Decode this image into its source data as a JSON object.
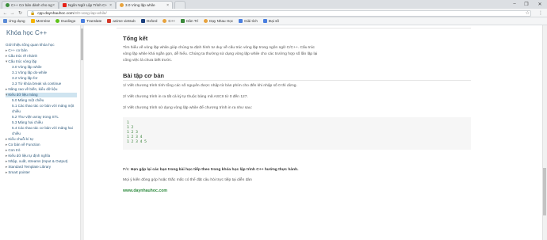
{
  "browser": {
    "tabs": [
      {
        "title": "C++ Cơ bản dành cho ng",
        "favicon_color": "#3d8f3d",
        "active": false
      },
      {
        "title": "Ngôn Ngữ Lập Trình C+",
        "favicon_color": "#e62117",
        "active": false
      },
      {
        "title": "3.0 Vòng lặp while",
        "favicon_color": "#e8a33d",
        "active": true
      }
    ],
    "window_controls": [
      "–",
      "❐",
      "✕"
    ],
    "url_host": "cpp.daynhauhoc.com",
    "url_path": "/3/0-vong-lap-while/",
    "url_scheme_icon": "lock-icon",
    "bookmarks": [
      {
        "label": "Ứng dụng",
        "color": "#5b8bd6"
      },
      {
        "label": "Memrise",
        "color": "#f5b400"
      },
      {
        "label": "Duolingo",
        "color": "#5fc31a"
      },
      {
        "label": "Translate",
        "color": "#4a7fe0"
      },
      {
        "label": "anime vietsub",
        "color": "#d33a2c"
      },
      {
        "label": "Oxford",
        "color": "#1b3f7d"
      },
      {
        "label": "C++",
        "color": "#e8a33d"
      },
      {
        "label": "Dân Trí",
        "color": "#3b8a3b"
      },
      {
        "label": "Dạy Nhau Học",
        "color": "#e8a33d"
      },
      {
        "label": "Giải tích",
        "color": "#4a7fe0"
      },
      {
        "label": "Đại số",
        "color": "#4a7fe0"
      }
    ]
  },
  "sidebar": {
    "title": "Khóa học C++",
    "items": [
      {
        "label": "Giới thiệu tổng quan khóa học",
        "indent": 0,
        "prefix": ""
      },
      {
        "label": "C++ cơ bản",
        "indent": 0,
        "prefix": "▸"
      },
      {
        "label": "Cấu trúc rẽ nhánh",
        "indent": 0,
        "prefix": "▸"
      },
      {
        "label": "Cấu trúc vòng lặp",
        "indent": 0,
        "prefix": "▾"
      },
      {
        "label": "3.0 Vòng lặp while",
        "indent": 1,
        "prefix": ""
      },
      {
        "label": "3.1 Vòng lặp do-while",
        "indent": 1,
        "prefix": ""
      },
      {
        "label": "3.2 Vòng lặp for",
        "indent": 1,
        "prefix": ""
      },
      {
        "label": "3.3 Từ khóa break và continue",
        "indent": 1,
        "prefix": ""
      },
      {
        "label": "Nâng cao về biến, kiểu dữ liệu",
        "indent": 0,
        "prefix": "▸"
      },
      {
        "label": "Kiểu dữ liệu mảng",
        "indent": 0,
        "prefix": "▾",
        "active": true
      },
      {
        "label": "5.0 Mảng một chiều",
        "indent": 1,
        "prefix": ""
      },
      {
        "label": "5.1 Các thao tác cơ bản với mảng một",
        "indent": 1,
        "prefix": ""
      },
      {
        "label": "chiều",
        "indent": 1,
        "prefix": ""
      },
      {
        "label": "5.2 Thư viện array trong STL",
        "indent": 1,
        "prefix": ""
      },
      {
        "label": "5.3 Mảng hai chiều",
        "indent": 1,
        "prefix": ""
      },
      {
        "label": "5.4 Các thao tác cơ bản với mảng hai",
        "indent": 1,
        "prefix": ""
      },
      {
        "label": "chiều",
        "indent": 1,
        "prefix": ""
      },
      {
        "label": "Kiểu chuỗi kí tự",
        "indent": 0,
        "prefix": "▸"
      },
      {
        "label": "Cơ bản về Function",
        "indent": 0,
        "prefix": "▸"
      },
      {
        "label": "Con trỏ",
        "indent": 0,
        "prefix": "▸"
      },
      {
        "label": "Kiểu dữ liệu tự định nghĩa",
        "indent": 0,
        "prefix": "▸"
      },
      {
        "label": "Nhập, xuất, streams (Input & Output)",
        "indent": 0,
        "prefix": "▸"
      },
      {
        "label": "Standard Template Library",
        "indent": 0,
        "prefix": "▸"
      },
      {
        "label": "Smart pointer",
        "indent": 0,
        "prefix": "▸"
      }
    ]
  },
  "main": {
    "summary_heading": "Tổng kết",
    "summary_lines": [
      "Tìm hiểu về vòng lặp while giúp chúng ta định hình tư duy về cấu trúc vòng lặp trong ngôn ngữ C/C++. Cấu trúc",
      "vòng lặp while khá ngắn gọn, dễ hiểu. Chúng ta thường sử dụng vòng lặp while cho các trường hợp số lần lặp lại",
      "công việc là chưa biết trước."
    ],
    "exercise_heading": "Bài tập cơ bản",
    "exercises": [
      "1/ Viết chương trình tính tổng các số nguyên được nhập từ bàn phím cho đến khi nhập số 0 thì dừng.",
      "2/ Viết chương trình in ra tất cả ký tự thuộc bảng mã ASCII từ 0 đến 127.",
      "3/ Viết chương trình sử dụng vòng lặp while để chương trình in ra như sau:"
    ],
    "code_lines": [
      "1",
      "1 2",
      "1 2 3",
      "1 2 3 4",
      "1 2 3 4 5"
    ],
    "ps_prefix": "P/s: ",
    "ps_text": "Hẹn gặp lại các bạn trong bài học tiếp theo trong khóa học lập trình C++ hướng thực hành.",
    "feedback": "Mọi ý kiến đóng góp hoặc thắc mắc có thể đặt câu hỏi trực tiếp tại diễn đàn",
    "site_link": "www.daynhauhoc.com"
  }
}
